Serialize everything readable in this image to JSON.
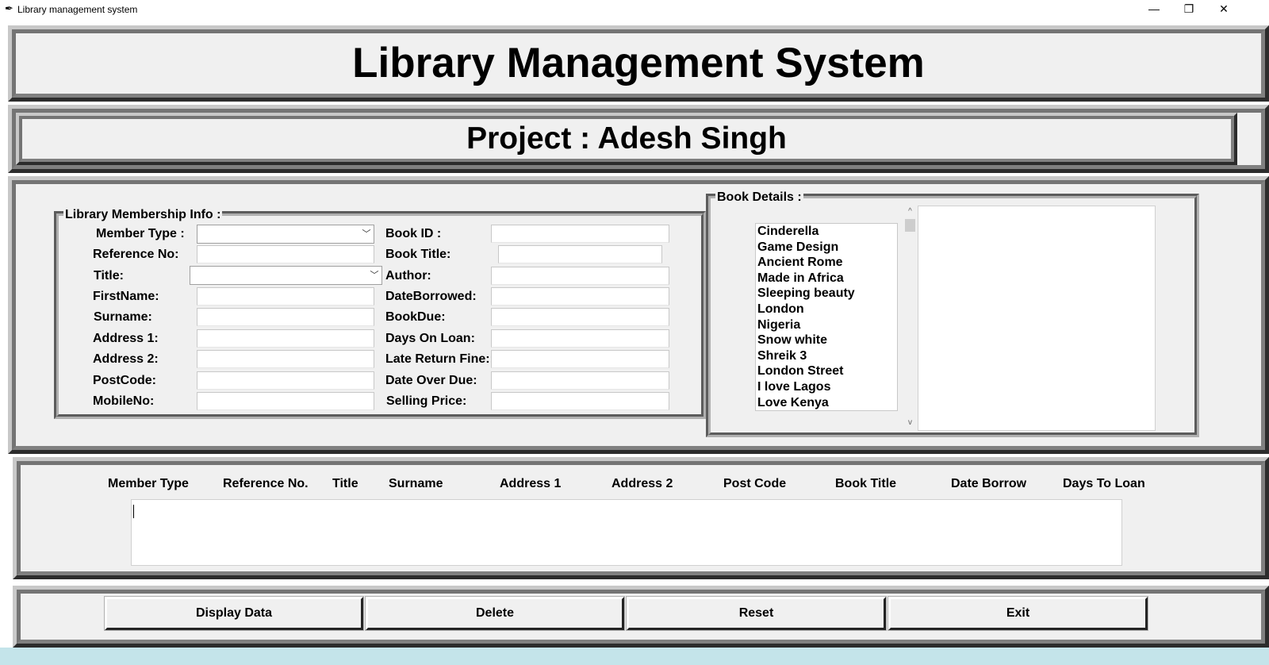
{
  "window": {
    "title": "Library management system",
    "icon": "feather-icon",
    "controls": {
      "minimize": "—",
      "restore": "❐",
      "close": "✕"
    }
  },
  "header": {
    "title": "Library Management System",
    "subtitle": "Project : Adesh Singh"
  },
  "membership": {
    "legend": "Library Membership Info :",
    "member_type": {
      "label": "Member Type :",
      "value": ""
    },
    "reference_no": {
      "label": "Reference No:",
      "value": ""
    },
    "title": {
      "label": "Title:",
      "value": ""
    },
    "firstname": {
      "label": "FirstName:",
      "value": ""
    },
    "surname": {
      "label": "Surname:",
      "value": ""
    },
    "address1": {
      "label": "Address 1:",
      "value": ""
    },
    "address2": {
      "label": "Address 2:",
      "value": ""
    },
    "postcode": {
      "label": "PostCode:",
      "value": ""
    },
    "mobileno": {
      "label": "MobileNo:",
      "value": ""
    },
    "book_id": {
      "label": "Book ID :",
      "value": ""
    },
    "book_title": {
      "label": "Book Title:",
      "value": ""
    },
    "author": {
      "label": "Author:",
      "value": ""
    },
    "date_borrowed": {
      "label": "DateBorrowed:",
      "value": ""
    },
    "book_due": {
      "label": "BookDue:",
      "value": ""
    },
    "days_on_loan": {
      "label": "Days On Loan:",
      "value": ""
    },
    "late_return_fine": {
      "label": "Late Return Fine:",
      "value": ""
    },
    "date_over_due": {
      "label": "Date Over Due:",
      "value": ""
    },
    "selling_price": {
      "label": "Selling Price:",
      "value": ""
    }
  },
  "book_details": {
    "legend": "Book Details  :",
    "books": [
      "Cinderella",
      "Game Design",
      "Ancient Rome",
      "Made in Africa",
      "Sleeping beauty",
      "London",
      "Nigeria",
      "Snow white",
      "Shreik 3",
      "London Street",
      "I love Lagos",
      "Love Kenya"
    ],
    "scroll_up": "^",
    "scroll_down": "v"
  },
  "records": {
    "columns": [
      "Member Type",
      "Reference No.",
      "Title",
      "Surname",
      "Address 1",
      "Address 2",
      "Post Code",
      "Book Title",
      "Date Borrow",
      "Days To Loan"
    ],
    "text": ""
  },
  "buttons": {
    "display": "Display Data",
    "delete": "Delete",
    "reset": "Reset",
    "exit": "Exit"
  }
}
